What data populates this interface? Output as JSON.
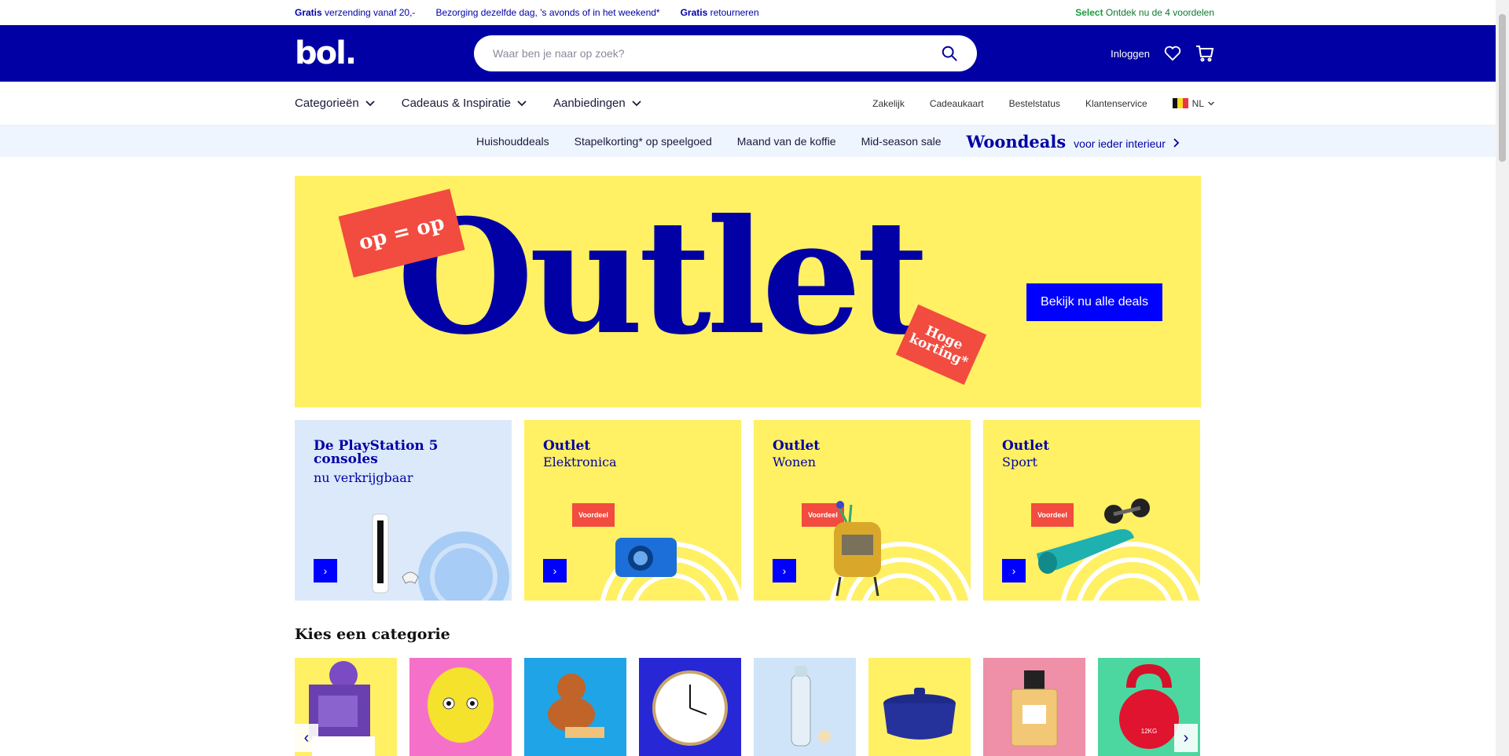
{
  "usp": {
    "items": [
      {
        "bold": "Gratis",
        "text": " verzending vanaf 20,-"
      },
      {
        "bold": "",
        "text": "Bezorging dezelfde dag, 's avonds of in het weekend*"
      },
      {
        "bold": "Gratis",
        "text": " retourneren"
      }
    ],
    "select_bold": "Select",
    "select_text": " Ontdek nu de 4 voordelen"
  },
  "header": {
    "logo": "bol.",
    "search_placeholder": "Waar ben je naar op zoek?",
    "login": "Inloggen"
  },
  "nav": {
    "left": [
      "Categorieën",
      "Cadeaus & Inspiratie",
      "Aanbiedingen"
    ],
    "right": [
      "Zakelijk",
      "Cadeaukaart",
      "Bestelstatus",
      "Klantenservice"
    ],
    "language": "NL"
  },
  "promo": {
    "links": [
      "Huishouddeals",
      "Stapelkorting* op speelgoed",
      "Maand van de koffie",
      "Mid-season sale"
    ],
    "woondeals": "Woondeals",
    "woondeals_sub": "voor ieder interieur"
  },
  "hero": {
    "title": "Outlet",
    "sticker1": "op = op",
    "sticker2_line1": "Hoge",
    "sticker2_line2": "korting*",
    "cta": "Bekijk nu alle deals"
  },
  "cards": [
    {
      "title": "De PlayStation 5 consoles",
      "subtitle": "nu verkrijgbaar"
    },
    {
      "title": "Outlet",
      "subtitle": "Elektronica",
      "badge": "Voordeel"
    },
    {
      "title": "Outlet",
      "subtitle": "Wonen",
      "badge": "Voordeel"
    },
    {
      "title": "Outlet",
      "subtitle": "Sport",
      "badge": "Voordeel"
    }
  ],
  "categories": {
    "title": "Kies een categorie",
    "tiles": [
      {
        "name": "books",
        "bg": "#fff064"
      },
      {
        "name": "toys",
        "bg": "#f571c9"
      },
      {
        "name": "baby",
        "bg": "#1fa4e8"
      },
      {
        "name": "clock",
        "bg": "#2727d6"
      },
      {
        "name": "bottle",
        "bg": "#cfe4f8"
      },
      {
        "name": "pan",
        "bg": "#fff064"
      },
      {
        "name": "perfume",
        "bg": "#ef8fa8"
      },
      {
        "name": "kettlebell",
        "bg": "#4dd7a0",
        "label": "12KG"
      }
    ]
  },
  "colors": {
    "brand": "#0000a4",
    "accent": "#0000ff",
    "yellow": "#fff064",
    "red": "#f24b3f"
  }
}
